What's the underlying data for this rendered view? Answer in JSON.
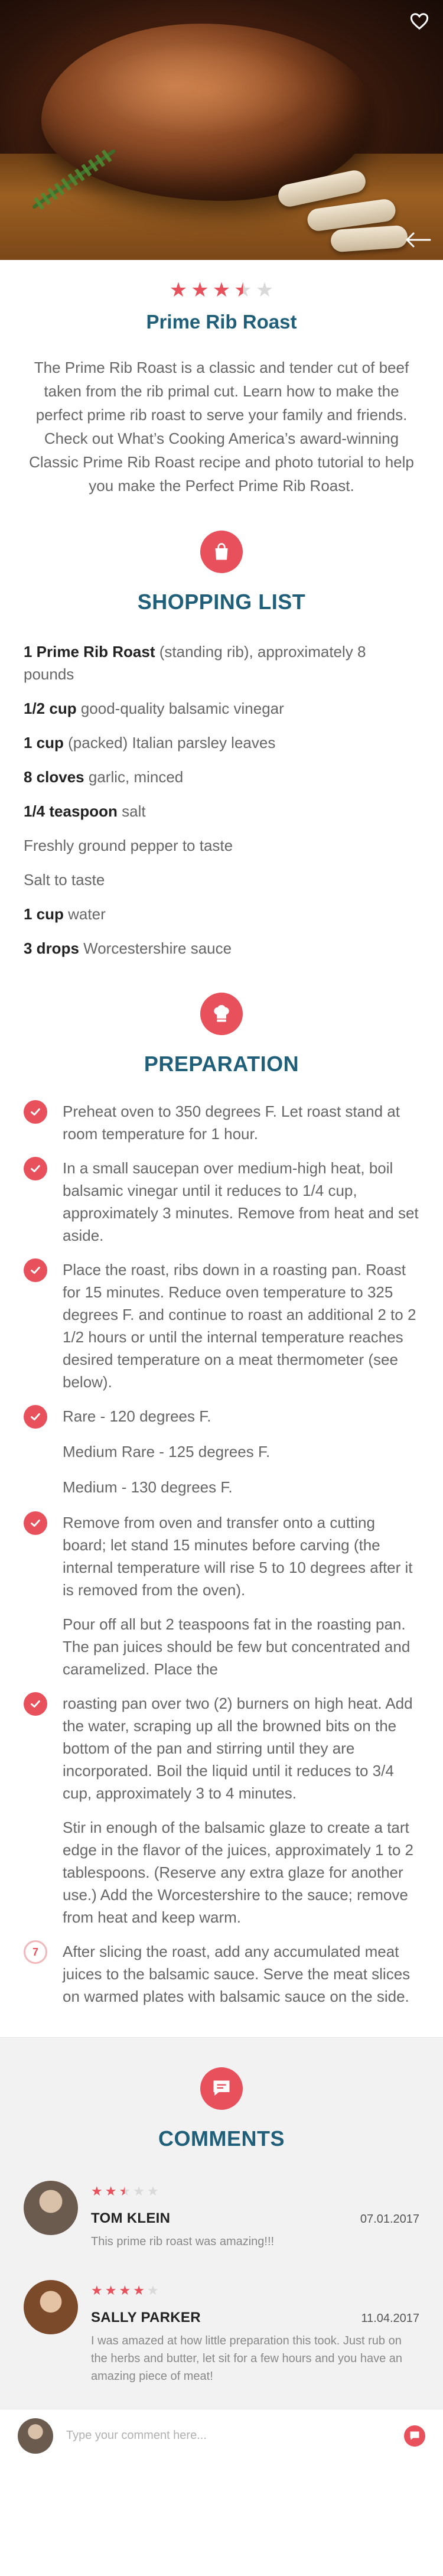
{
  "recipe": {
    "rating": {
      "value": 3.5,
      "max": 5
    },
    "title": "Prime Rib Roast",
    "intro": "The Prime Rib Roast is a classic and tender cut of beef taken from the rib primal cut.  Learn how to make the perfect prime rib roast to serve your family and friends.  Check out What’s Cooking America’s award-winning Classic Prime Rib Roast recipe and photo tutorial to help you make the Perfect Prime Rib Roast."
  },
  "icons": {
    "favorite": "heart-outline-icon",
    "back": "arrow-left-icon",
    "shopping": "shopping-bag-icon",
    "preparation": "chef-hat-icon",
    "comments": "chat-bubble-icon",
    "step_done": "check-icon",
    "send": "send-icon"
  },
  "colors": {
    "accent": "#e8505b",
    "heading": "#1f5f7a",
    "text": "#666666"
  },
  "shopping": {
    "title": "SHOPPING LIST",
    "items": [
      {
        "qty": "1 Prime Rib Roast",
        "desc": " (standing rib), approximately 8 pounds"
      },
      {
        "qty": "1/2 cup",
        "desc": " good-quality balsamic vinegar"
      },
      {
        "qty": "1 cup",
        "desc": " (packed) Italian parsley leaves"
      },
      {
        "qty": "8 cloves",
        "desc": " garlic, minced"
      },
      {
        "qty": "1/4 teaspoon",
        "desc": " salt"
      },
      {
        "qty": "",
        "desc": "Freshly ground pepper to taste"
      },
      {
        "qty": "",
        "desc": "Salt to taste"
      },
      {
        "qty": "1 cup",
        "desc": " water"
      },
      {
        "qty": "3 drops",
        "desc": " Worcestershire sauce"
      }
    ]
  },
  "preparation": {
    "title": "PREPARATION",
    "steps": [
      {
        "state": "done",
        "text": "Preheat oven to 350 degrees F.  Let roast stand at room temperature for 1 hour."
      },
      {
        "state": "done",
        "text": "In a small saucepan over medium-high heat, boil balsamic vinegar until it reduces to 1/4 cup, approximately 3 minutes.  Remove from heat and set aside."
      },
      {
        "state": "done",
        "text": "Place the roast, ribs down in a roasting pan.  Roast for 15 minutes. Reduce oven temperature to 325 degrees F. and continue to roast an additional 2 to 2 1/2 hours or until the internal temperature reaches desired temperature on a meat thermometer (see below)."
      },
      {
        "state": "done",
        "text": "Rare - 120 degrees F."
      },
      {
        "state": "none",
        "text": "Medium Rare - 125 degrees F."
      },
      {
        "state": "none",
        "text": "Medium - 130 degrees F."
      },
      {
        "state": "done",
        "text": "Remove from oven and transfer onto a cutting board; let stand 15 minutes before carving (the internal temperature will rise 5 to 10 degrees after it is removed from the oven)."
      },
      {
        "state": "none",
        "text": "Pour off all but 2 teaspoons fat in the roasting pan.  The pan juices should be few but concentrated and caramelized.  Place the"
      },
      {
        "state": "done",
        "text": "roasting pan over two (2) burners on high heat.  Add the water, scraping up all the browned bits on the bottom of the pan and stirring until they are incorporated.  Boil the liquid until it reduces to 3/4 cup, approximately 3 to 4 minutes."
      },
      {
        "state": "none",
        "text": "Stir in enough of the balsamic glaze to create a tart edge in the flavor of the juices, approximately 1 to 2 tablespoons.  (Reserve any extra glaze for another use.) Add the Worcestershire to the sauce; remove from heat and keep warm."
      },
      {
        "state": "open",
        "number": "7",
        "text": "After slicing the roast, add any accumulated meat juices to the balsamic sauce.  Serve the meat slices on warmed plates with balsamic sauce on the side."
      }
    ]
  },
  "comments": {
    "title": "COMMENTS",
    "items": [
      {
        "name": "TOM KLEIN",
        "date": "07.01.2017",
        "rating": 2.5,
        "text": "This prime rib roast was amazing!!!",
        "avatar": "male"
      },
      {
        "name": "SALLY PARKER",
        "date": "11.04.2017",
        "rating": 4,
        "text": "I was amazed at how little preparation this took. Just rub on the herbs and butter, let sit for a few hours and you have an amazing piece of meat!",
        "avatar": "female"
      }
    ]
  },
  "composer": {
    "placeholder": "Type your comment here..."
  }
}
